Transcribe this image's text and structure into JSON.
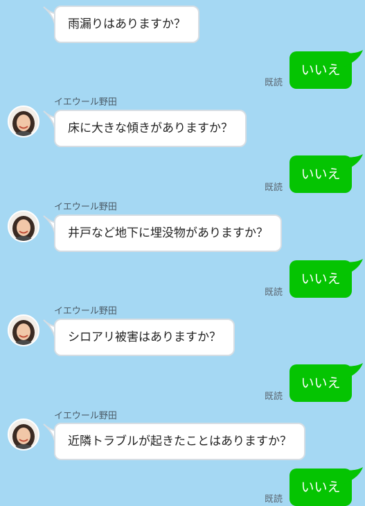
{
  "colors": {
    "background": "#a5d8f3",
    "outgoing_bubble": "#05c402",
    "incoming_bubble": "#ffffff"
  },
  "messages": [
    {
      "side": "in",
      "sender": "",
      "avatar": false,
      "text": "雨漏りはありますか？"
    },
    {
      "side": "out",
      "text": "いいえ",
      "read": "既読"
    },
    {
      "side": "in",
      "sender": "イエウール野田",
      "avatar": true,
      "text": "床に大きな傾きがありますか？"
    },
    {
      "side": "out",
      "text": "いいえ",
      "read": "既読"
    },
    {
      "side": "in",
      "sender": "イエウール野田",
      "avatar": true,
      "text": "井戸など地下に埋没物がありますか？"
    },
    {
      "side": "out",
      "text": "いいえ",
      "read": "既読"
    },
    {
      "side": "in",
      "sender": "イエウール野田",
      "avatar": true,
      "text": "シロアリ被害はありますか？"
    },
    {
      "side": "out",
      "text": "いいえ",
      "read": "既読"
    },
    {
      "side": "in",
      "sender": "イエウール野田",
      "avatar": true,
      "text": "近隣トラブルが起きたことはありますか？"
    },
    {
      "side": "out",
      "text": "いいえ",
      "read": "既読"
    }
  ]
}
